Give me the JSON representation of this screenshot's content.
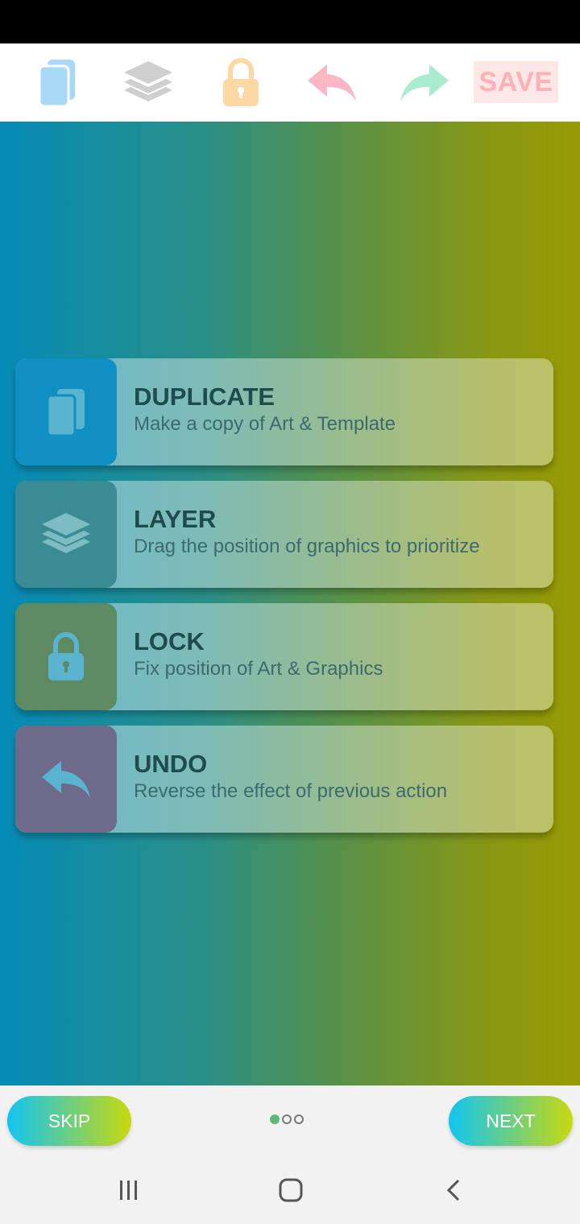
{
  "toolbar": {
    "icons": [
      "duplicate-icon",
      "layers-icon",
      "lock-icon",
      "undo-icon",
      "redo-icon"
    ],
    "save_label": "SAVE",
    "colors": {
      "duplicate": "#a7d9f6",
      "layers": "#cfcfcf",
      "lock": "#fbd8a4",
      "undo": "#fcb6c6",
      "redo": "#a9ecd0",
      "save_text": "#fdb0b6",
      "save_bg": "#fde7e7"
    }
  },
  "cards": [
    {
      "title": "DUPLICATE",
      "description": "Make a copy of Art & Template",
      "icon": "duplicate-icon",
      "badge_color": "#0f8fc2"
    },
    {
      "title": "LAYER",
      "description": "Drag the position of graphics to prioritize",
      "icon": "layers-icon",
      "badge_color": "#3a8b93"
    },
    {
      "title": "LOCK",
      "description": "Fix position of Art & Graphics",
      "icon": "lock-icon",
      "badge_color": "#5d8a62"
    },
    {
      "title": "UNDO",
      "description": "Reverse the effect of previous action",
      "icon": "undo-icon",
      "badge_color": "#6e6a8a"
    }
  ],
  "onboarding": {
    "skip_label": "SKIP",
    "next_label": "NEXT",
    "page_count": 3,
    "current_page": 1
  },
  "system_nav": [
    "recent-apps-icon",
    "home-icon",
    "back-icon"
  ]
}
